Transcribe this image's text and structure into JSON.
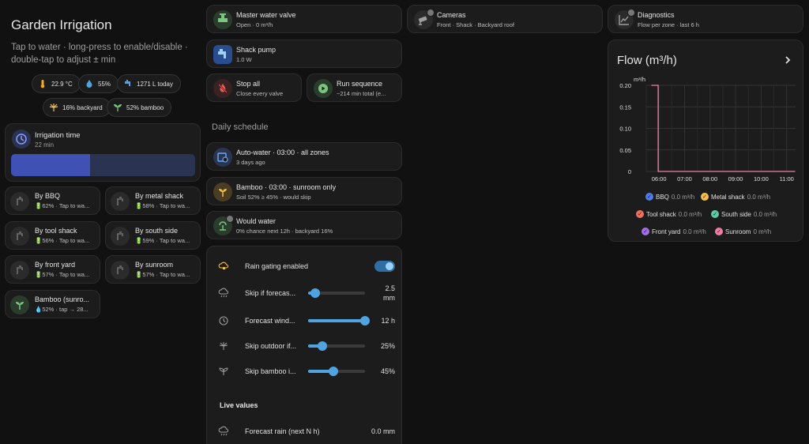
{
  "header": {
    "title": "Garden Irrigation",
    "subtitle": "Tap to water · long-press to enable/disable · double-tap to adjust ± min"
  },
  "chips": [
    {
      "icon": "thermometer-icon",
      "text": "22.9 °C"
    },
    {
      "icon": "water-drop-icon",
      "text": "55%"
    },
    {
      "icon": "water-tap-icon",
      "text": "1271 L today"
    },
    {
      "icon": "sprinkler-icon",
      "text": "16% backyard"
    },
    {
      "icon": "sprout-icon",
      "text": "52% bamboo"
    }
  ],
  "irrigation_time": {
    "label": "Irrigation time",
    "value": "22 min",
    "level_fraction": 0.43
  },
  "zones": [
    {
      "name": "By BBQ",
      "status": "🔋62% · Tap to wa..."
    },
    {
      "name": "By metal shack",
      "status": "🔋58% · Tap to wa..."
    },
    {
      "name": "By tool shack",
      "status": "🔋56% · Tap to wa..."
    },
    {
      "name": "By south side",
      "status": "🔋59% · Tap to wa..."
    },
    {
      "name": "By front yard",
      "status": "🔋57% · Tap to wa..."
    },
    {
      "name": "By sunroom",
      "status": "🔋57% · Tap to wa..."
    },
    {
      "name": "Bamboo (sunro...",
      "status": "💧52% · tap → 28..."
    }
  ],
  "tiles": {
    "master_valve": {
      "name": "Master water valve",
      "sub": "Open · 0 m³/h"
    },
    "shack_pump": {
      "name": "Shack pump",
      "sub": "1.0 W"
    },
    "stop_all": {
      "name": "Stop all",
      "sub": "Close every valve"
    },
    "run_sequence": {
      "name": "Run sequence",
      "sub": "~214 min total (e..."
    },
    "cameras": {
      "name": "Cameras",
      "sub": "Front · Shack · Backyard roof"
    },
    "diagnostics": {
      "name": "Diagnostics",
      "sub": "Flow per zone · last 6 h"
    }
  },
  "schedule": {
    "heading": "Daily schedule",
    "items": [
      {
        "name": "Auto-water · 03:00 · all zones",
        "sub": "3 days ago"
      },
      {
        "name": "Bamboo · 03:00 · sunroom only",
        "sub": "Soil 52% ≥ 45% · would skip"
      },
      {
        "name": "Would water",
        "sub": "0% chance next 12h · backyard 16%"
      }
    ]
  },
  "rain": {
    "toggle_label": "Rain gating enabled",
    "toggle_on": true,
    "sliders": [
      {
        "label": "Skip if forecas...",
        "value": "2.5\nmm",
        "fraction": 0.12
      },
      {
        "label": "Forecast wind...",
        "value": "12 h",
        "fraction": 1.0
      },
      {
        "label": "Skip outdoor if...",
        "value": "25%",
        "fraction": 0.25
      },
      {
        "label": "Skip bamboo i...",
        "value": "45%",
        "fraction": 0.45
      }
    ],
    "live_heading": "Live values",
    "live": [
      {
        "label": "Forecast rain (next N h)",
        "value": "0.0 mm"
      }
    ]
  },
  "flow_card": {
    "title": "Flow (m³/h)"
  },
  "chart_data": {
    "type": "line",
    "title": "Flow (m³/h)",
    "ylabel": "m³/h",
    "ylim": [
      0,
      0.2
    ],
    "yticks": [
      "0.20",
      "0.15",
      "0.10",
      "0.05",
      "0"
    ],
    "xticks": [
      "06:00",
      "07:00",
      "08:00",
      "09:00",
      "10:00",
      "11:00"
    ],
    "grid": true,
    "series": [
      {
        "name": "BBQ",
        "color": "#4f7be8",
        "points": [],
        "legend_value": "0.0 m³/h"
      },
      {
        "name": "Metal shack",
        "color": "#f5c04a",
        "points": [],
        "legend_value": "0.0 m³/h"
      },
      {
        "name": "Tool shack",
        "color": "#f06e5c",
        "points": [],
        "legend_value": "0.0 m³/h"
      },
      {
        "name": "South side",
        "color": "#5fc9a8",
        "points": [],
        "legend_value": "0.0 m³/h"
      },
      {
        "name": "Front yard",
        "color": "#a46ee8",
        "points": [],
        "legend_value": "0.0 m³/h"
      },
      {
        "name": "Sunroom",
        "color": "#f27ea8",
        "points": [
          [
            "05:42",
            0.2
          ],
          [
            "05:58",
            0.2
          ],
          [
            "05:58",
            0
          ],
          [
            "11:20",
            0
          ]
        ],
        "legend_value": "0 m³/h"
      }
    ]
  },
  "colors": {
    "accent": "#3f51b5",
    "slider": "#4fa3e0",
    "pump": "#2a4d8f"
  }
}
